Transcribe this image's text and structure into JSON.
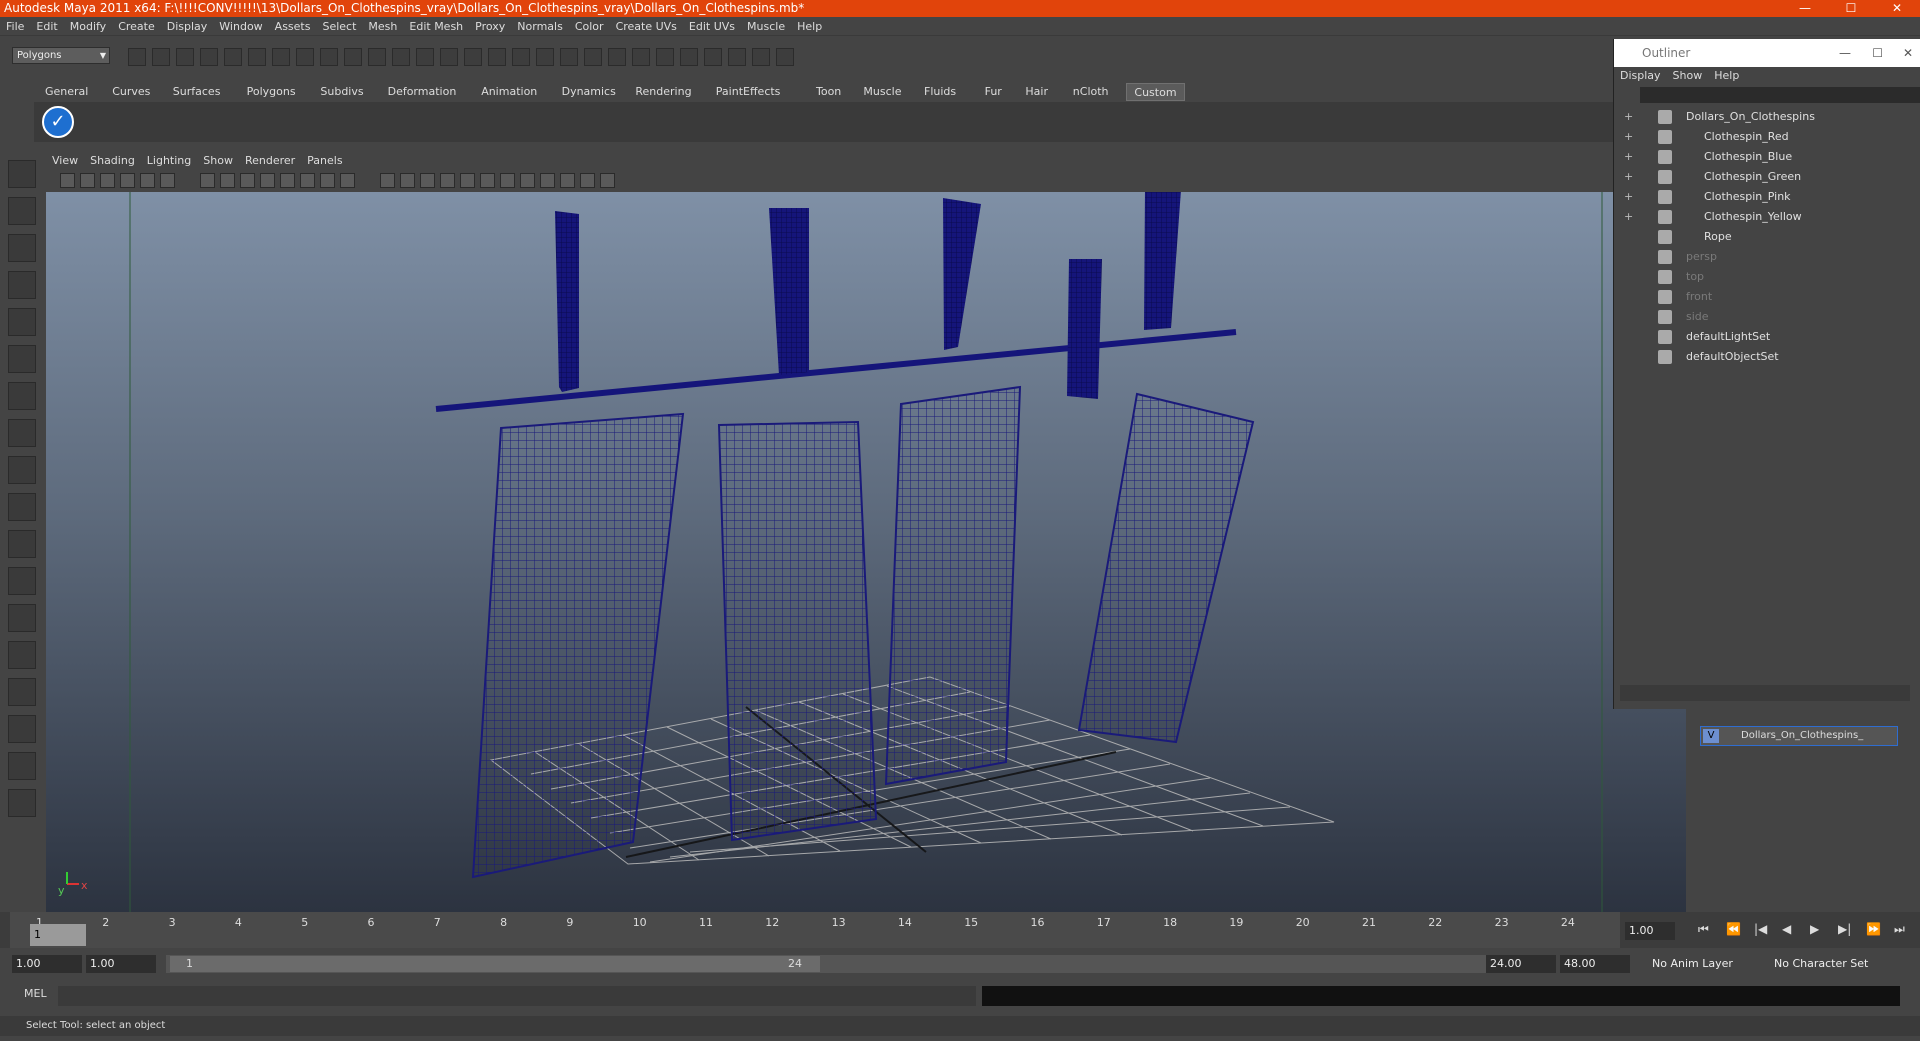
{
  "window": {
    "title": "Autodesk Maya 2011 x64: F:\\!!!!CONV!!!!!\\13\\Dollars_On_Clothespins_vray\\Dollars_On_Clothespins_vray\\Dollars_On_Clothespins.mb*"
  },
  "menubar": [
    "File",
    "Edit",
    "Modify",
    "Create",
    "Display",
    "Window",
    "Assets",
    "Select",
    "Mesh",
    "Edit Mesh",
    "Proxy",
    "Normals",
    "Color",
    "Create UVs",
    "Edit UVs",
    "Muscle",
    "Help"
  ],
  "mode_selector": "Polygons",
  "shelf_tabs": [
    "General",
    "Curves",
    "Surfaces",
    "Polygons",
    "Subdivs",
    "Deformation",
    "Animation",
    "Dynamics",
    "Rendering",
    "PaintEffects",
    "Toon",
    "Muscle",
    "Fluids",
    "Fur",
    "Hair",
    "nCloth",
    "Custom"
  ],
  "active_shelf_tab": "Custom",
  "viewport_menu": [
    "View",
    "Shading",
    "Lighting",
    "Show",
    "Renderer",
    "Panels"
  ],
  "outliner": {
    "title": "Outliner",
    "menu": [
      "Display",
      "Show",
      "Help"
    ],
    "items": [
      {
        "label": "Dollars_On_Clothespins",
        "indent": 0,
        "dim": false
      },
      {
        "label": "Clothespin_Red",
        "indent": 1,
        "dim": false
      },
      {
        "label": "Clothespin_Blue",
        "indent": 1,
        "dim": false
      },
      {
        "label": "Clothespin_Green",
        "indent": 1,
        "dim": false
      },
      {
        "label": "Clothespin_Pink",
        "indent": 1,
        "dim": false
      },
      {
        "label": "Clothespin_Yellow",
        "indent": 1,
        "dim": false
      },
      {
        "label": "Rope",
        "indent": 1,
        "dim": false
      },
      {
        "label": "persp",
        "indent": 0,
        "dim": true
      },
      {
        "label": "top",
        "indent": 0,
        "dim": true
      },
      {
        "label": "front",
        "indent": 0,
        "dim": true
      },
      {
        "label": "side",
        "indent": 0,
        "dim": true
      },
      {
        "label": "defaultLightSet",
        "indent": 0,
        "dim": false
      },
      {
        "label": "defaultObjectSet",
        "indent": 0,
        "dim": false
      }
    ]
  },
  "layer": {
    "visible": "V",
    "name": "Dollars_On_Clothespins_"
  },
  "timeline": {
    "ticks": [
      "1",
      "2",
      "3",
      "4",
      "5",
      "6",
      "7",
      "8",
      "9",
      "10",
      "11",
      "12",
      "13",
      "14",
      "15",
      "16",
      "17",
      "18",
      "19",
      "20",
      "21",
      "22",
      "23",
      "24"
    ],
    "current": "1",
    "current_time": "1.00"
  },
  "range": {
    "start": "1.00",
    "start2": "1.00",
    "slider_start": "1",
    "slider_end": "24",
    "end": "24.00",
    "end2": "48.00",
    "anim_layer": "No Anim Layer",
    "char_set": "No Character Set"
  },
  "mel": {
    "label": "MEL"
  },
  "help_line": "Select Tool: select an object",
  "colors": {
    "title_bar": "#e1440b",
    "wireframe": "#1a1a7a",
    "active_tab": "#5b5b5b"
  }
}
